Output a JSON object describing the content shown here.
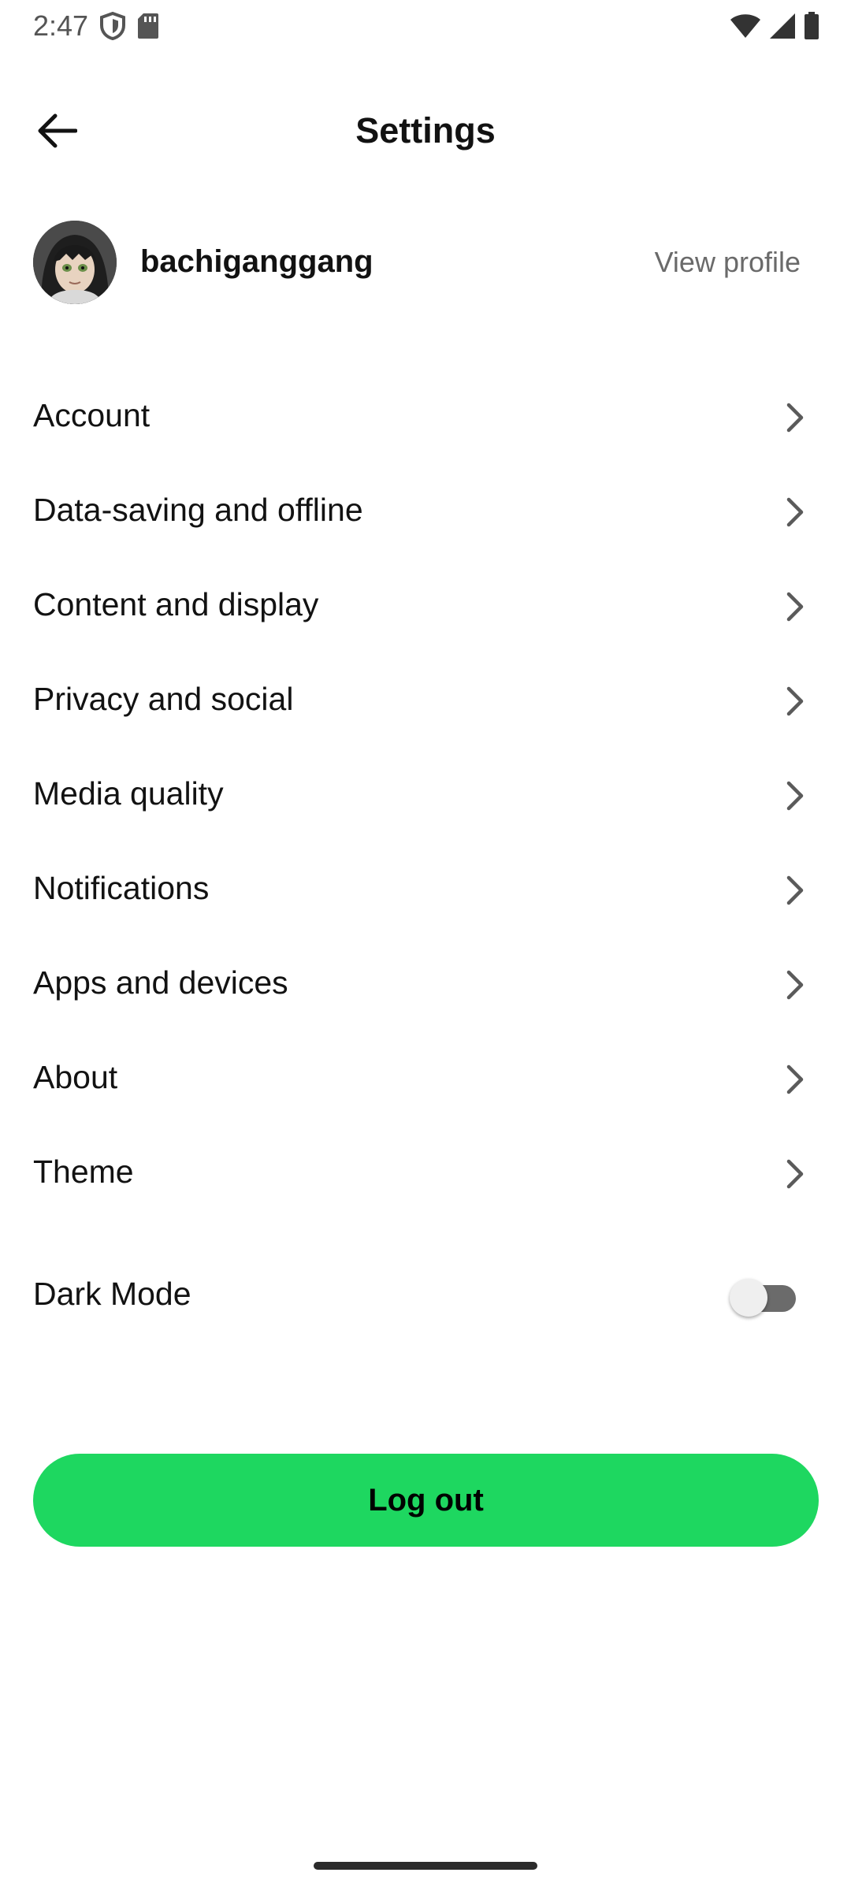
{
  "status_bar": {
    "time": "2:47",
    "icons": [
      "shield-icon",
      "sd-card-icon",
      "wifi-icon",
      "cell-signal-icon",
      "battery-icon"
    ]
  },
  "header": {
    "title": "Settings",
    "back_icon": "arrow-left-icon"
  },
  "profile": {
    "username": "bachiganggang",
    "view_profile_label": "View profile"
  },
  "settings": {
    "items": [
      {
        "label": "Account"
      },
      {
        "label": "Data-saving and offline"
      },
      {
        "label": "Content and display"
      },
      {
        "label": "Privacy and social"
      },
      {
        "label": "Media quality"
      },
      {
        "label": "Notifications"
      },
      {
        "label": "Apps and devices"
      },
      {
        "label": "About"
      },
      {
        "label": "Theme"
      }
    ]
  },
  "dark_mode": {
    "label": "Dark Mode",
    "enabled": false
  },
  "logout": {
    "label": "Log out"
  },
  "colors": {
    "accent": "#1ed760",
    "text_primary": "#121212",
    "text_secondary": "#6a6a6a",
    "background": "#ffffff"
  }
}
